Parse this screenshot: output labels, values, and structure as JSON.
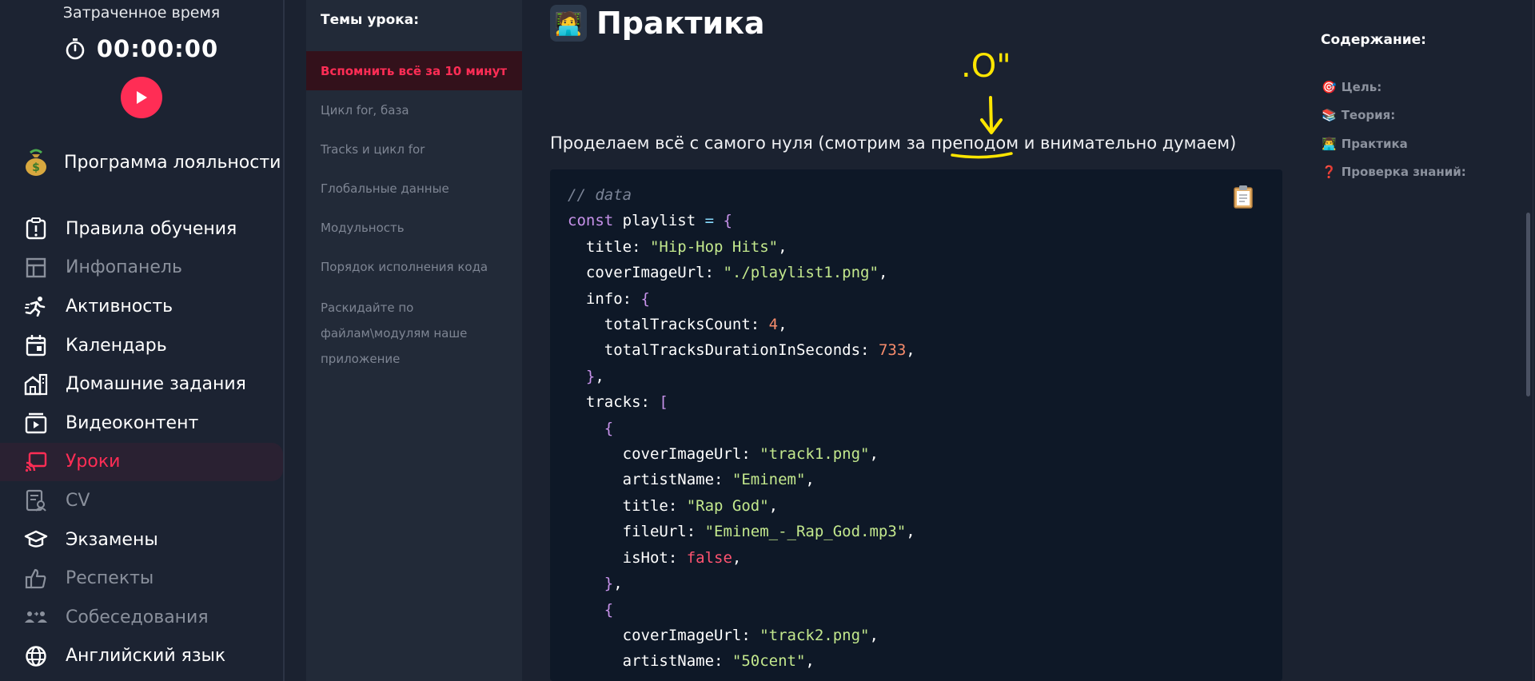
{
  "timer": {
    "caption": "Затраченное время",
    "value": "00:00:00"
  },
  "loyalty": {
    "label": "Программа лояльности"
  },
  "nav": [
    {
      "label": "Правила обучения",
      "icon": "rules-icon",
      "state": "normal"
    },
    {
      "label": "Инфопанель",
      "icon": "dashboard-icon",
      "state": "dim"
    },
    {
      "label": "Активность",
      "icon": "running-icon",
      "state": "normal"
    },
    {
      "label": "Календарь",
      "icon": "calendar-icon",
      "state": "normal"
    },
    {
      "label": "Домашние задания",
      "icon": "homework-icon",
      "state": "normal"
    },
    {
      "label": "Видеоконтент",
      "icon": "video-icon",
      "state": "normal"
    },
    {
      "label": "Уроки",
      "icon": "lessons-icon",
      "state": "active"
    },
    {
      "label": "CV",
      "icon": "cv-icon",
      "state": "dim"
    },
    {
      "label": "Экзамены",
      "icon": "graduation-cap-icon",
      "state": "normal"
    },
    {
      "label": "Респекты",
      "icon": "thumbs-up-icon",
      "state": "dim"
    },
    {
      "label": "Собеседования",
      "icon": "people-icon",
      "state": "dim"
    },
    {
      "label": "Английский язык",
      "icon": "globe-icon",
      "state": "normal"
    }
  ],
  "topics": {
    "title": "Темы урока:",
    "items": [
      "Вспомнить всё за 10 минут",
      "Цикл for, база",
      "Tracks и цикл for",
      "Глобальные данные",
      "Модульность",
      "Порядок исполнения кода",
      "Раскидайте по файлам\\модулям наше приложение"
    ]
  },
  "main": {
    "heading_icon": "🧑‍💻",
    "heading": "Практика",
    "lead": "Проделаем всё с самого нуля (смотрим за преподом и внимательно думаем)",
    "annotation": ".O\""
  },
  "code": [
    "// data",
    "const playlist = {",
    "  title: \"Hip-Hop Hits\",",
    "  coverImageUrl: \"./playlist1.png\",",
    "  info: {",
    "    totalTracksCount: 4,",
    "    totalTracksDurationInSeconds: 733,",
    "  },",
    "  tracks: [",
    "    {",
    "      coverImageUrl: \"track1.png\",",
    "      artistName: \"Eminem\",",
    "      title: \"Rap God\",",
    "      fileUrl: \"Eminem_-_Rap_God.mp3\",",
    "      isHot: false,",
    "    },",
    "    {",
    "      coverImageUrl: \"track2.png\",",
    "      artistName: \"50cent\","
  ],
  "toc": {
    "title": "Содержание:",
    "items": [
      {
        "icon": "🎯",
        "label": "Цель:"
      },
      {
        "icon": "📚",
        "label": "Теория:"
      },
      {
        "icon": "👨‍💻",
        "label": "Практика"
      },
      {
        "icon": "❓",
        "label": "Проверка знаний:"
      }
    ]
  },
  "colors": {
    "accent": "#ff2d55",
    "background": "#1b2230",
    "code_bg": "#0e1827",
    "string": "#c3e88d",
    "number": "#f78c6c",
    "keyword": "#c792ea",
    "annotation": "#ffe600"
  }
}
